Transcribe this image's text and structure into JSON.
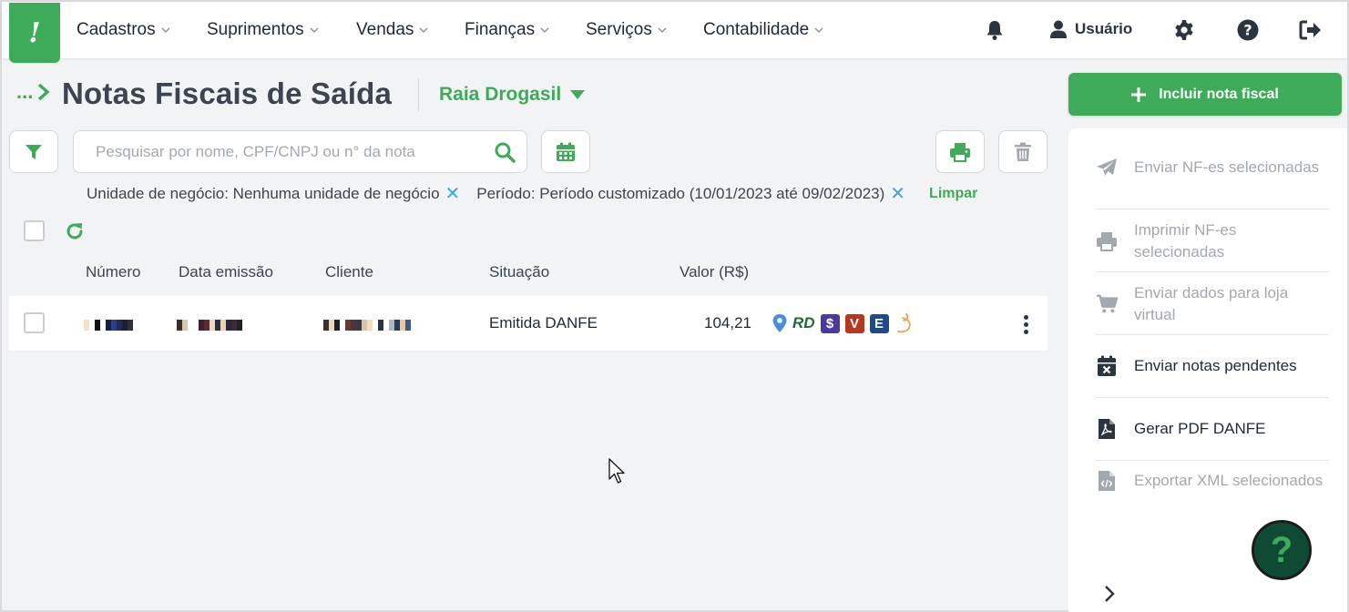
{
  "nav": {
    "logo": "!",
    "items": [
      {
        "label": "Cadastros"
      },
      {
        "label": "Suprimentos"
      },
      {
        "label": "Vendas"
      },
      {
        "label": "Finanças"
      },
      {
        "label": "Serviços"
      },
      {
        "label": "Contabilidade"
      }
    ],
    "user_label": "Usuário"
  },
  "header": {
    "breadcrumb_ellipsis": "...",
    "title": "Notas Fiscais de Saída",
    "store": "Raia Drogasil",
    "include_label": "Incluir nota fiscal"
  },
  "search": {
    "placeholder": "Pesquisar por nome, CPF/CNPJ ou n° da nota",
    "value": ""
  },
  "filters": {
    "chips": [
      {
        "label": "Unidade de negócio: Nenhuma unidade de negócio"
      },
      {
        "label": "Período: Período customizado (10/01/2023 até 09/02/2023)"
      }
    ],
    "clear_label": "Limpar"
  },
  "table": {
    "columns": [
      "Número",
      "Data emissão",
      "Cliente",
      "Situação",
      "Valor (R$)"
    ],
    "rows": [
      {
        "numero": "",
        "data_emissao": "",
        "cliente": "",
        "situacao": "Emitida DANFE",
        "valor": "104,21"
      }
    ],
    "row_badges": [
      "RD",
      "$",
      "V",
      "E"
    ]
  },
  "side_actions": [
    {
      "label": "Enviar NF-es selecionadas",
      "icon": "paper-plane-icon",
      "enabled": false
    },
    {
      "label": "Imprimir NF-es selecionadas",
      "icon": "printer-icon",
      "enabled": false
    },
    {
      "label": "Enviar dados para loja virtual",
      "icon": "cart-icon",
      "enabled": false
    },
    {
      "label": "Enviar notas pendentes",
      "icon": "calendar-x-icon",
      "enabled": true
    },
    {
      "label": "Gerar PDF DANFE",
      "icon": "pdf-file-icon",
      "enabled": true
    },
    {
      "label": "Exportar XML selecionados",
      "icon": "code-file-icon",
      "enabled": false
    }
  ],
  "help_label": "?",
  "colors": {
    "brand_green": "#3dab57",
    "text_dark": "#2c3440",
    "muted": "#a3a8ae",
    "chip_close": "#37a6d9",
    "help_bg": "#0f4a35"
  }
}
